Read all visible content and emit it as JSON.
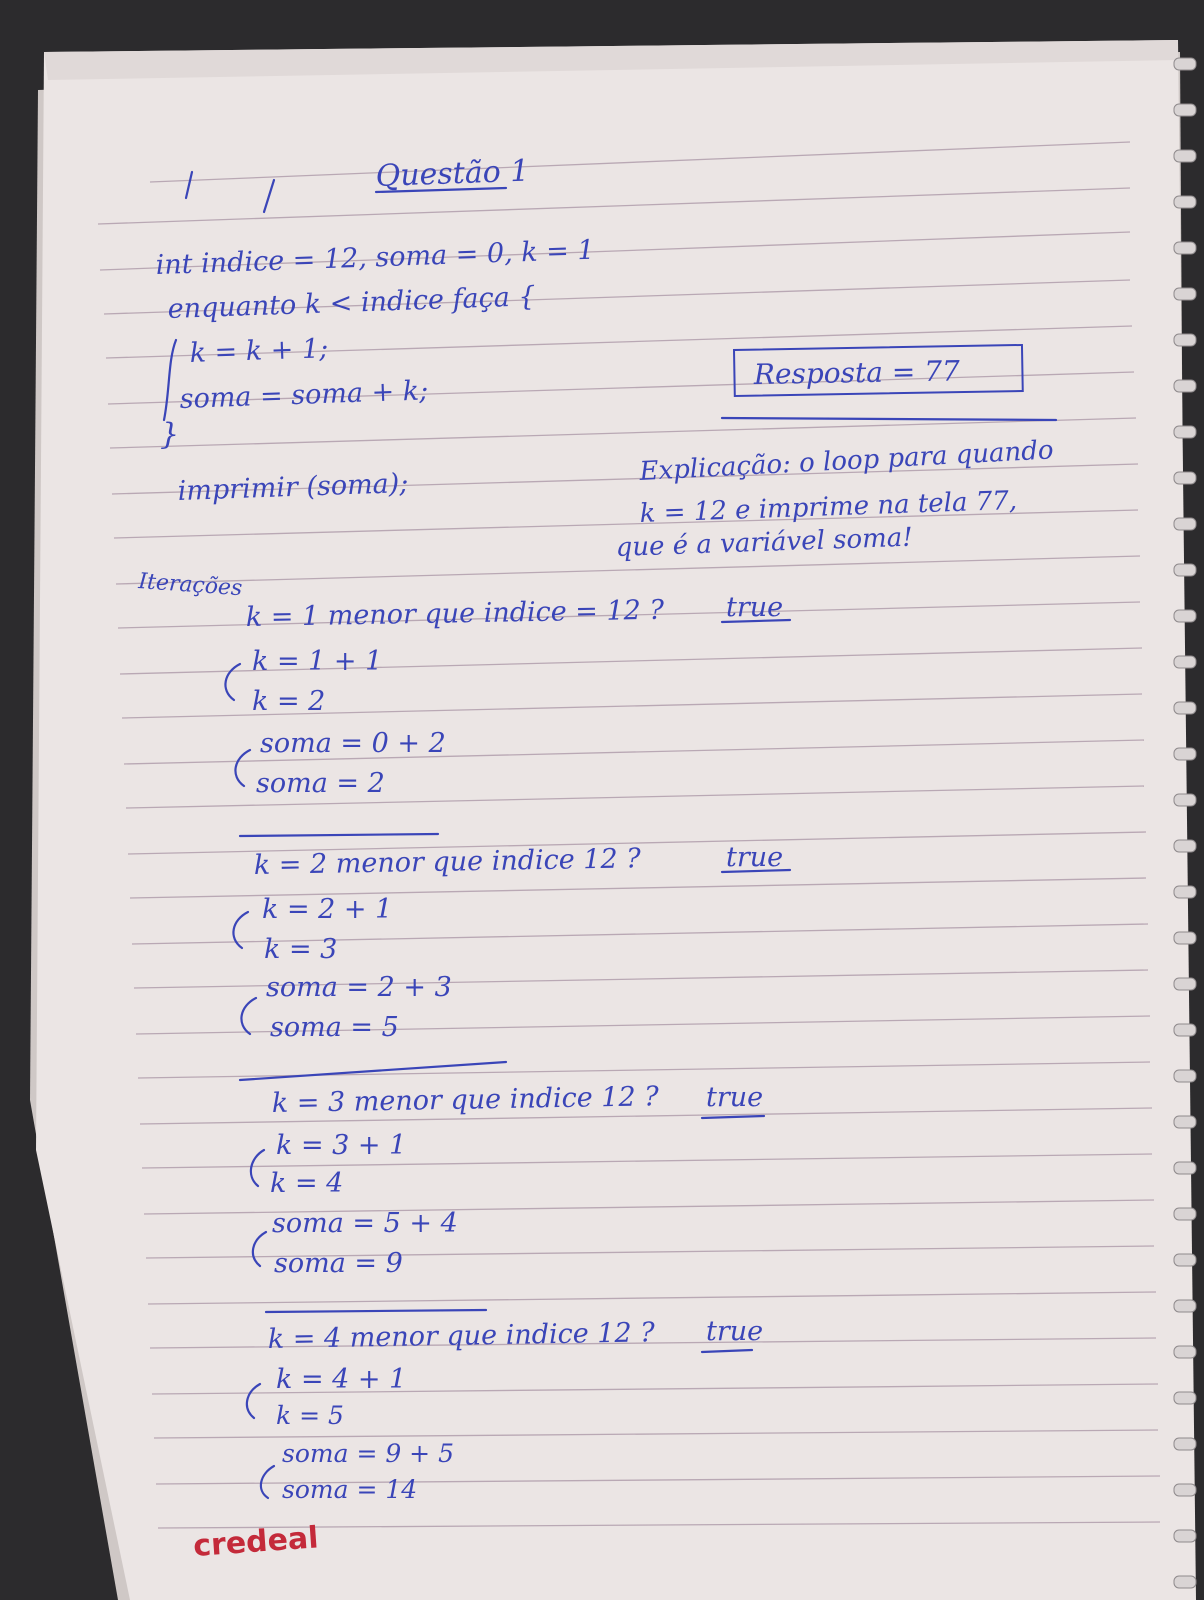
{
  "colors": {
    "background": "#2c2b2d",
    "paper": "#ece6e6",
    "ink": "#3a45b8",
    "rule_lines": "#b9a8b4",
    "brand": "#c42a3a"
  },
  "title": "Questão 1",
  "code": {
    "declaration": "int indice = 12, soma = 0, k = 1",
    "loop_header": "enquanto k < indice faça {",
    "body_line_1": "k = k + 1;",
    "body_line_2": "soma = soma + k;",
    "closing": "}",
    "print": "imprimir (soma);"
  },
  "answer": "Resposta = 77",
  "explanation": {
    "line_1": "Explicação: o loop para quando",
    "line_2": "k = 12 e imprime na tela 77,",
    "line_3": "que é a variável soma!"
  },
  "iterations_label": "Iterações",
  "iterations": [
    {
      "condition": "k = 1 menor que indice = 12 ?",
      "result": "true",
      "k_expr": "k = 1 + 1",
      "k_val": "k = 2",
      "soma_expr": "soma = 0 + 2",
      "soma_val": "soma = 2"
    },
    {
      "condition": "k = 2 menor que indice 12 ?",
      "result": "true",
      "k_expr": "k = 2 + 1",
      "k_val": "k = 3",
      "soma_expr": "soma = 2 + 3",
      "soma_val": "soma = 5"
    },
    {
      "condition": "k = 3 menor que indice 12 ?",
      "result": "true",
      "k_expr": "k = 3 + 1",
      "k_val": "k = 4",
      "soma_expr": "soma = 5 + 4",
      "soma_val": "soma = 9"
    },
    {
      "condition": "k = 4 menor que indice 12 ?",
      "result": "true",
      "k_expr": "k = 4 + 1",
      "k_val": "k = 5",
      "soma_expr": "soma = 9 + 5",
      "soma_val": "soma = 14"
    }
  ],
  "brand": "credeal"
}
